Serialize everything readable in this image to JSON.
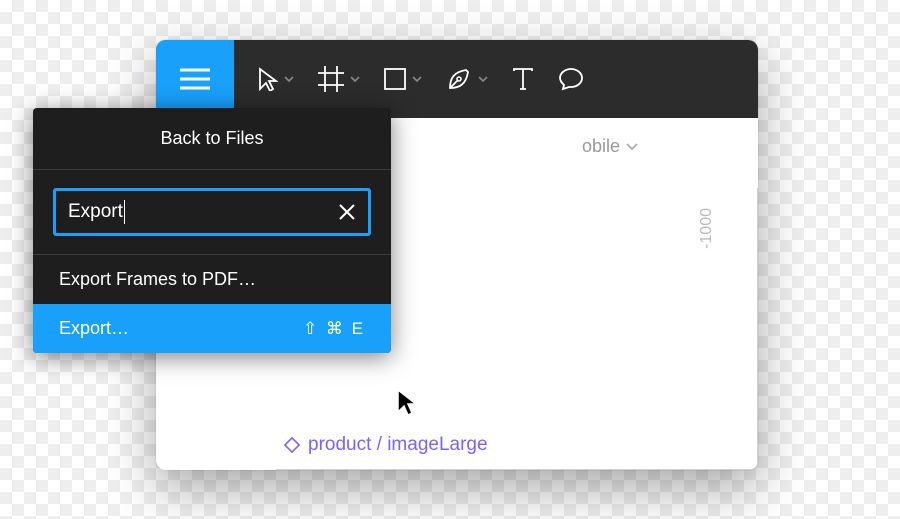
{
  "toolbar": {
    "tools": [
      "move",
      "frame",
      "rectangle",
      "pen",
      "text",
      "comment"
    ]
  },
  "canvas": {
    "breadcrumb_partial": "obile",
    "ruler_value": "-1000",
    "component_label": "product / imageLarge"
  },
  "menu": {
    "back_label": "Back to Files",
    "search_value": "Export",
    "results": {
      "pdf": "Export Frames to PDF…",
      "export": "Export…",
      "export_shortcut": "⇧ ⌘ E"
    }
  }
}
